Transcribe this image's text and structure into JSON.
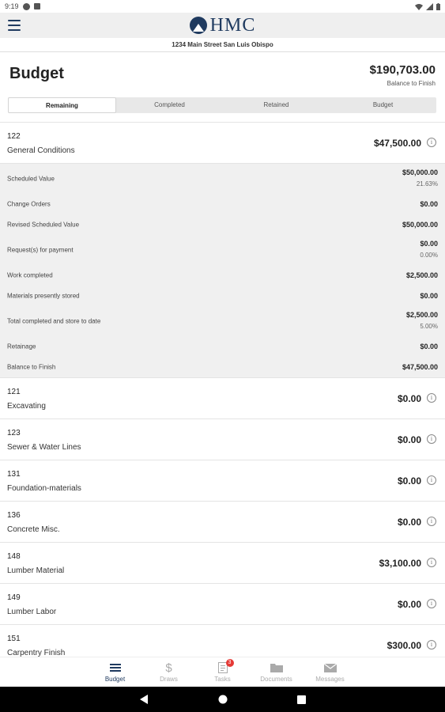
{
  "status_bar": {
    "time": "9:19"
  },
  "app": {
    "logo_text": "HMC",
    "address": "1234 Main Street San Luis Obispo"
  },
  "header": {
    "title": "Budget",
    "total": "$190,703.00",
    "total_label": "Balance to Finish"
  },
  "tabs": [
    {
      "label": "Remaining",
      "active": true
    },
    {
      "label": "Completed",
      "active": false
    },
    {
      "label": "Retained",
      "active": false
    },
    {
      "label": "Budget",
      "active": false
    }
  ],
  "expanded_item": {
    "code": "122",
    "name": "General Conditions",
    "amount": "$47,500.00",
    "details": [
      {
        "label": "Scheduled Value",
        "value": "$50,000.00",
        "sub": "21.63%"
      },
      {
        "label": "Change Orders",
        "value": "$0.00",
        "sub": ""
      },
      {
        "label": "Revised Scheduled Value",
        "value": "$50,000.00",
        "sub": ""
      },
      {
        "label": "Request(s) for payment",
        "value": "$0.00",
        "sub": "0.00%"
      },
      {
        "label": "Work completed",
        "value": "$2,500.00",
        "sub": ""
      },
      {
        "label": "Materials presently stored",
        "value": "$0.00",
        "sub": ""
      },
      {
        "label": "Total completed and store to date",
        "value": "$2,500.00",
        "sub": "5.00%"
      },
      {
        "label": "Retainage",
        "value": "$0.00",
        "sub": ""
      },
      {
        "label": "Balance to Finish",
        "value": "$47,500.00",
        "sub": ""
      }
    ]
  },
  "items": [
    {
      "code": "121",
      "name": "Excavating",
      "amount": "$0.00"
    },
    {
      "code": "123",
      "name": "Sewer & Water Lines",
      "amount": "$0.00"
    },
    {
      "code": "131",
      "name": "Foundation-materials",
      "amount": "$0.00"
    },
    {
      "code": "136",
      "name": "Concrete Misc.",
      "amount": "$0.00"
    },
    {
      "code": "148",
      "name": "Lumber Material",
      "amount": "$3,100.00"
    },
    {
      "code": "149",
      "name": "Lumber Labor",
      "amount": "$0.00"
    },
    {
      "code": "151",
      "name": "Carpentry Finish",
      "amount": "$300.00"
    }
  ],
  "bottom_nav": [
    {
      "label": "Budget",
      "icon": "list-icon",
      "active": true
    },
    {
      "label": "Draws",
      "icon": "dollar-icon",
      "active": false
    },
    {
      "label": "Tasks",
      "icon": "tasks-icon",
      "active": false,
      "badge": "3"
    },
    {
      "label": "Documents",
      "icon": "folder-icon",
      "active": false
    },
    {
      "label": "Messages",
      "icon": "mail-icon",
      "active": false
    }
  ],
  "colors": {
    "brand": "#1f3a5f",
    "badge": "#e53935",
    "detail_bg": "#f0f0f0"
  }
}
